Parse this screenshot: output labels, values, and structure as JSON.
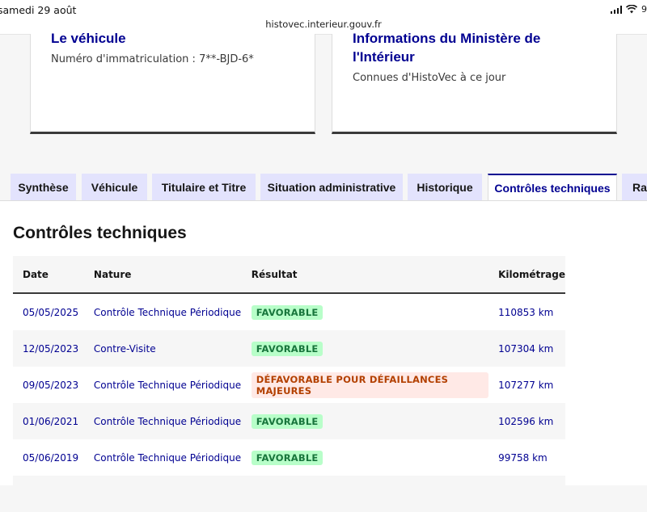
{
  "status_bar": {
    "time": "samedi 29 août",
    "url": "histovec.interieur.gouv.fr",
    "battery": "9"
  },
  "cards": {
    "vehicle": {
      "title": "Le véhicule",
      "text": "Numéro d'immatriculation : 7**-BJD-6*"
    },
    "ministry": {
      "title_line1": "Informations du Ministère de",
      "title_line2": "l'Intérieur",
      "text": "Connues d'HistoVec à ce jour"
    }
  },
  "tabs": [
    {
      "label": "Synthèse"
    },
    {
      "label": "Véhicule"
    },
    {
      "label": "Titulaire et Titre"
    },
    {
      "label": "Situation administrative"
    },
    {
      "label": "Historique"
    },
    {
      "label": "Contrôles techniques"
    },
    {
      "label": "Rap"
    }
  ],
  "section_title": "Contrôles techniques",
  "table": {
    "headers": {
      "date": "Date",
      "nature": "Nature",
      "result": "Résultat",
      "km": "Kilométrage"
    },
    "rows": [
      {
        "date": "05/05/2025",
        "nature": "Contrôle Technique Périodique",
        "result": "FAVORABLE",
        "km": "110853 km"
      },
      {
        "date": "12/05/2023",
        "nature": "Contre-Visite",
        "result": "FAVORABLE",
        "km": "107304 km"
      },
      {
        "date": "09/05/2023",
        "nature": "Contrôle Technique Périodique",
        "result": "DÉFAVORABLE POUR DÉFAILLANCES MAJEURES",
        "km": "107277 km"
      },
      {
        "date": "01/06/2021",
        "nature": "Contrôle Technique Périodique",
        "result": "FAVORABLE",
        "km": "102596 km"
      },
      {
        "date": "05/06/2019",
        "nature": "Contrôle Technique Périodique",
        "result": "FAVORABLE",
        "km": "99758 km"
      }
    ]
  },
  "colors": {
    "accent": "#000091",
    "tab_bg": "#e3e3fd",
    "success_bg": "#b8fec9",
    "success_text": "#18753c",
    "error_bg": "#ffe9e6",
    "error_text": "#b34000"
  }
}
